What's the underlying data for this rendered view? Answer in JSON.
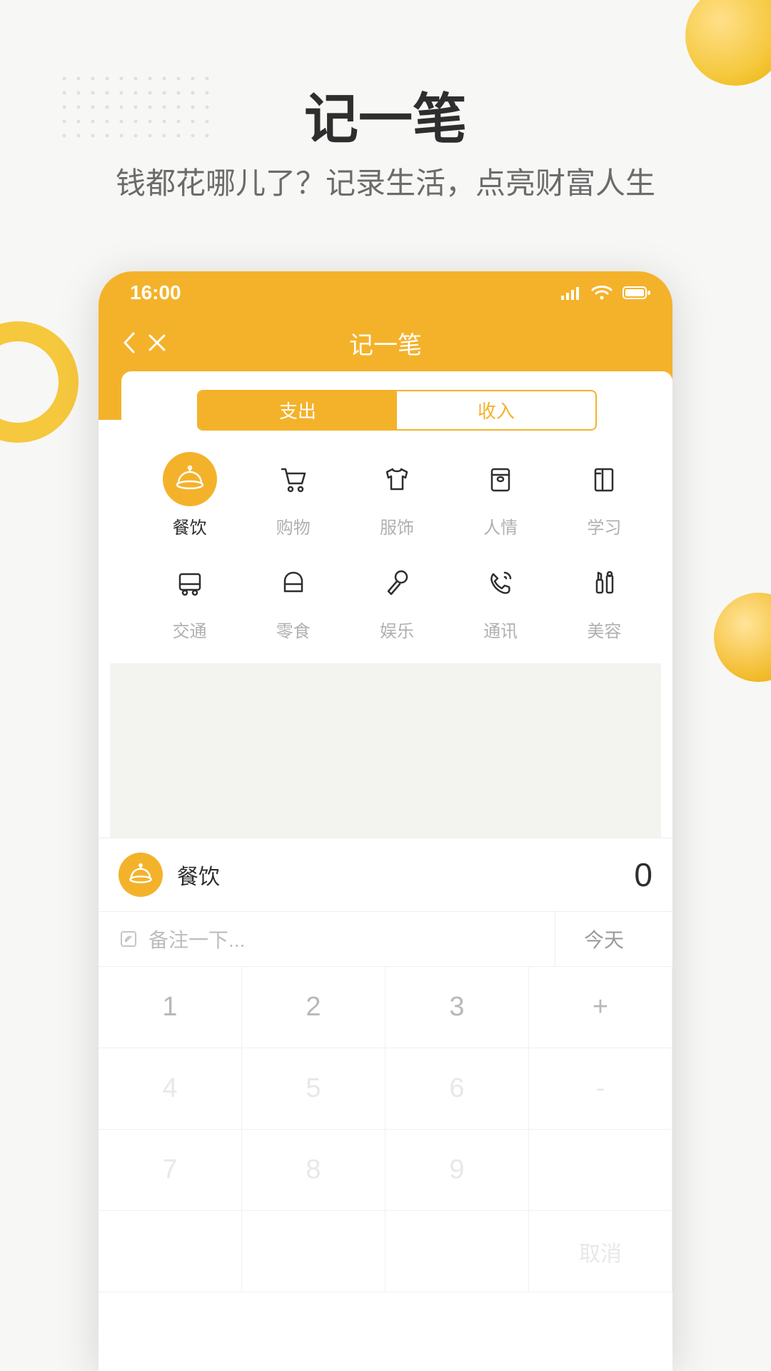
{
  "promo": {
    "title": "记一笔",
    "subtitle": "钱都花哪儿了？记录生活，点亮财富人生"
  },
  "status": {
    "time": "16:00"
  },
  "nav": {
    "title": "记一笔"
  },
  "tabs": {
    "expense": "支出",
    "income": "收入"
  },
  "categories": [
    {
      "label": "餐饮",
      "icon": "dish",
      "active": true
    },
    {
      "label": "购物",
      "icon": "cart"
    },
    {
      "label": "服饰",
      "icon": "shirt"
    },
    {
      "label": "人情",
      "icon": "gift"
    },
    {
      "label": "学习",
      "icon": "book"
    },
    {
      "label": "交通",
      "icon": "bus"
    },
    {
      "label": "零食",
      "icon": "snack"
    },
    {
      "label": "娱乐",
      "icon": "mic"
    },
    {
      "label": "通讯",
      "icon": "phone"
    },
    {
      "label": "美容",
      "icon": "beauty"
    }
  ],
  "amount": {
    "category": "餐饮",
    "value": "0"
  },
  "note": {
    "placeholder": "备注一下...",
    "date": "今天"
  },
  "keypad": {
    "r1": [
      "1",
      "2",
      "3",
      "+"
    ],
    "r2": [
      "4",
      "5",
      "6",
      "-"
    ],
    "r3": [
      "7",
      "8",
      "9",
      ""
    ],
    "r4": [
      "",
      "",
      "",
      "取消"
    ]
  }
}
